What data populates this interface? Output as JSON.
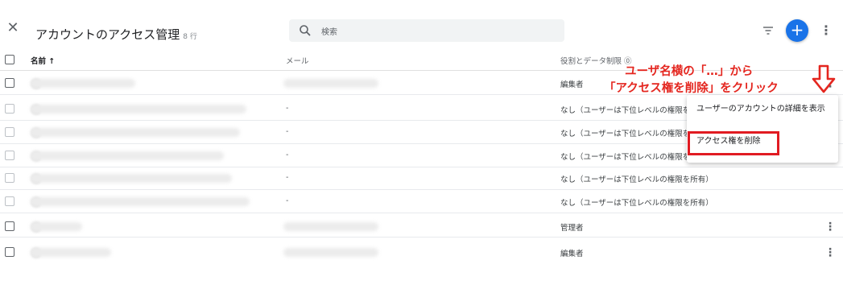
{
  "header": {
    "close_icon": "close-icon",
    "title": "アカウントのアクセス管理",
    "count": "8 行",
    "search_placeholder": "検索",
    "filter_icon": "filter-icon",
    "add_icon": "plus-icon",
    "accent_color": "#1a73e8"
  },
  "columns": {
    "name": "名前 ↑",
    "email": "メール",
    "role": "役割とデータ制限 ⓪"
  },
  "rows": [
    {
      "email": "",
      "role": "編集者",
      "menu": true
    },
    {
      "email": "-",
      "role": "なし（ユーザーは下位レベルの権限を所有）",
      "menu": false
    },
    {
      "email": "-",
      "role": "なし（ユーザーは下位レベルの権限を所有）",
      "menu": false
    },
    {
      "email": "-",
      "role": "なし（ユーザーは下位レベルの権限を所有）",
      "menu": false
    },
    {
      "email": "-",
      "role": "なし（ユーザーは下位レベルの権限を所有）",
      "menu": false
    },
    {
      "email": "-",
      "role": "なし（ユーザーは下位レベルの権限を所有）",
      "menu": false
    },
    {
      "email": "",
      "role": "管理者",
      "menu": true
    },
    {
      "email": "",
      "role": "編集者",
      "menu": true
    }
  ],
  "context_menu": {
    "items": [
      "ユーザーのアカウントの詳細を表示",
      "アクセス権を削除"
    ]
  },
  "annotation": {
    "line1": "ユーザ名横の「…」から",
    "line2": "「アクセス権を削除」をクリック",
    "color": "#e4261f"
  }
}
